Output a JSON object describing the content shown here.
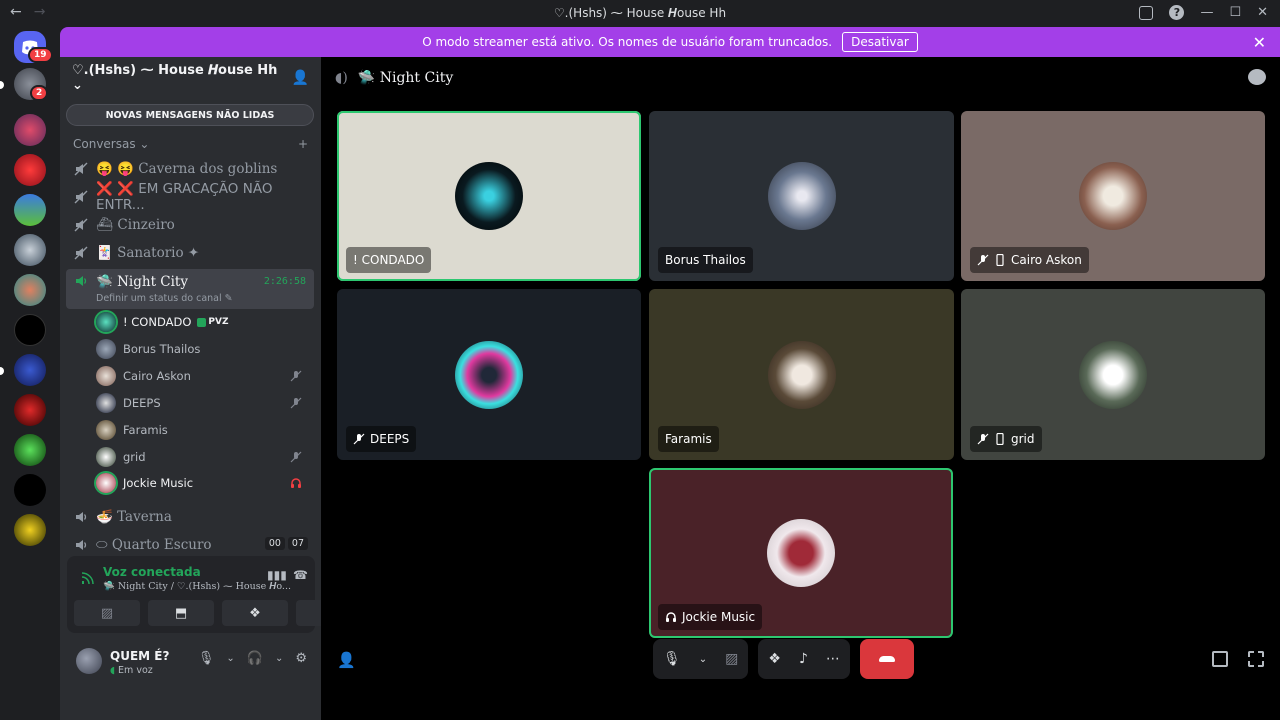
{
  "window": {
    "title": "♡.(Hshs) ⁓ House 𝑯ouse Hh"
  },
  "rail": {
    "dm_badge": "19",
    "server2_badge": "2"
  },
  "banner": {
    "text": "O modo streamer está ativo. Os nomes de usuário foram truncados.",
    "button": "Desativar"
  },
  "sidebar": {
    "server_name": "♡.(Hshs) ⁓ House 𝑯ouse Hh",
    "unread_pill": "NOVAS MENSAGENS NÃO LIDAS",
    "category": "Conversas",
    "channels": [
      {
        "name": "😝 😝 Caverna dos goblins"
      },
      {
        "name": "❌ ❌ EM GRACAÇÃO NÃO ENTR..."
      },
      {
        "name": "⛴ Cinzeiro"
      },
      {
        "name": "🃏 Sanatorio ✦"
      },
      {
        "name": "🛸 Night City",
        "time": "2:26:58",
        "status": "Definir um status do canal ✎"
      },
      {
        "name": "🍜 Taverna"
      },
      {
        "name": "⬭ Quarto Escuro",
        "badges": [
          "00",
          "07"
        ]
      }
    ],
    "members": [
      {
        "name": "! CONDADO",
        "tag": "PVZ"
      },
      {
        "name": "Borus Thailos"
      },
      {
        "name": "Cairo Askon"
      },
      {
        "name": "DEEPS"
      },
      {
        "name": "Faramis"
      },
      {
        "name": "grid"
      },
      {
        "name": "Jockie Music"
      }
    ]
  },
  "voice": {
    "status": "Voz conectada",
    "location": "🛸 Night City / ♡.(Hshs) ⁓ House 𝑯o..."
  },
  "user": {
    "name": "QUEM É?",
    "status": "Em voz"
  },
  "main": {
    "channel": "🛸 Night City",
    "tiles": [
      {
        "name": "! CONDADO"
      },
      {
        "name": "Borus Thailos"
      },
      {
        "name": "Cairo Askon"
      },
      {
        "name": "DEEPS"
      },
      {
        "name": "Faramis"
      },
      {
        "name": "grid"
      },
      {
        "name": "Jockie Music"
      }
    ]
  },
  "colors": {
    "accent_green": "#23a55a",
    "banner_purple": "#a33fe8",
    "hangup_red": "#da373c"
  }
}
